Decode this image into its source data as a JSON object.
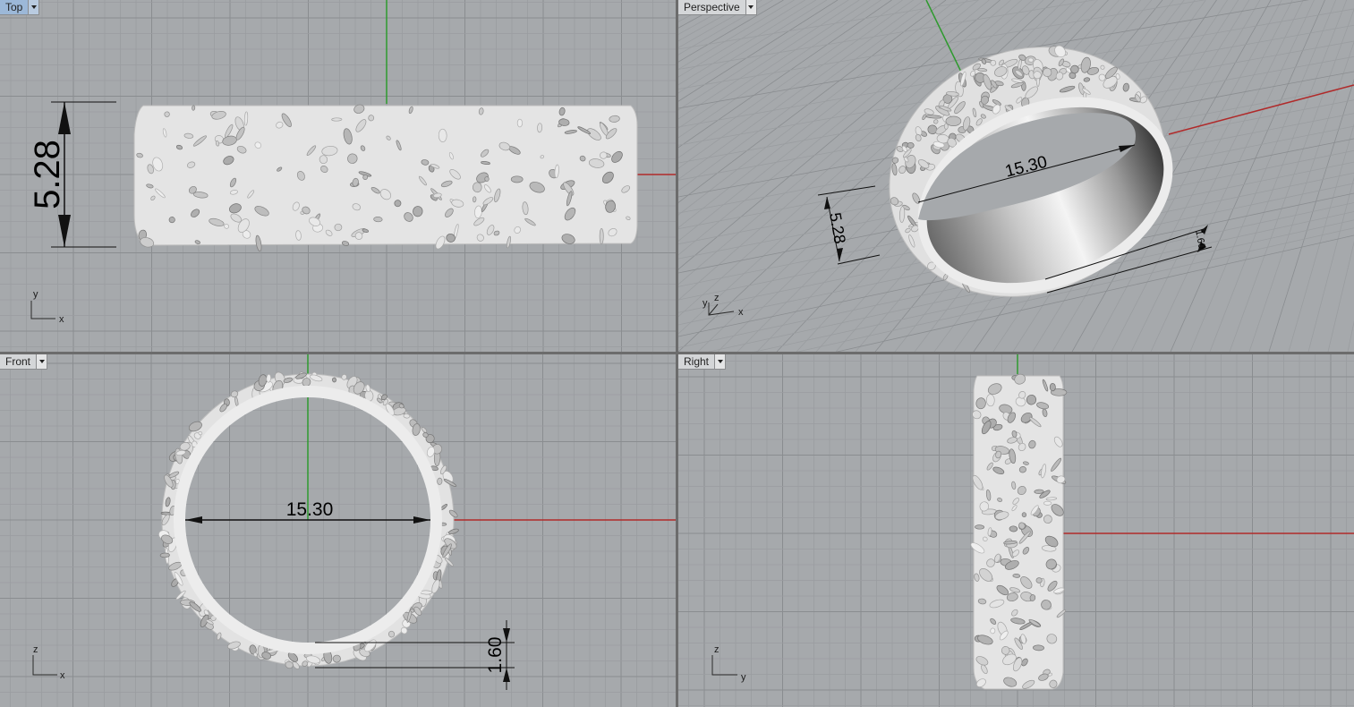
{
  "viewports": {
    "top": {
      "label": "Top",
      "active": true
    },
    "perspective": {
      "label": "Perspective",
      "active": false
    },
    "front": {
      "label": "Front",
      "active": false
    },
    "right": {
      "label": "Right",
      "active": false
    }
  },
  "dimensions": {
    "width": "5.28",
    "inner_diameter": "15.30",
    "thickness": "1.60",
    "thickness_persp": "1.60"
  },
  "axis_labels": {
    "top": {
      "h": "x",
      "v": "y"
    },
    "persp": {
      "v": "y",
      "z": "z",
      "h": "x"
    },
    "front": {
      "h": "x",
      "v": "z"
    },
    "right": {
      "h": "y",
      "v": "z"
    }
  },
  "colors": {
    "viewport_bg": "#a6a9ac",
    "grid_minor": "#9a9da0",
    "grid_major": "#8a8d90",
    "x_axis": "#b02a2a",
    "y_axis": "#2e9a2e",
    "ring_fill": "#e6e6e6",
    "active_tab": "#9cb8d8"
  }
}
